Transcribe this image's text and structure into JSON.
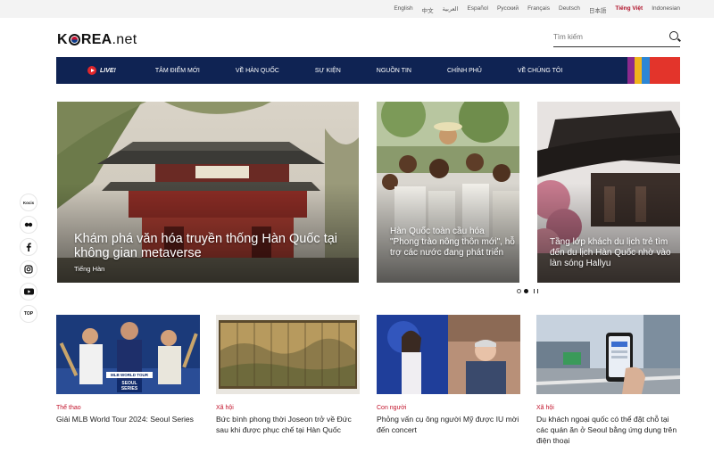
{
  "languages": [
    {
      "label": "English",
      "active": false
    },
    {
      "label": "中文",
      "active": false
    },
    {
      "label": "العربية",
      "active": false
    },
    {
      "label": "Español",
      "active": false
    },
    {
      "label": "Русский",
      "active": false
    },
    {
      "label": "Français",
      "active": false
    },
    {
      "label": "Deutsch",
      "active": false
    },
    {
      "label": "日本語",
      "active": false
    },
    {
      "label": "Tiếng Việt",
      "active": true
    },
    {
      "label": "Indonesian",
      "active": false
    }
  ],
  "logo": {
    "left": "K",
    "mid": "REA",
    "suffix": ".net"
  },
  "search": {
    "placeholder": "Tìm kiếm"
  },
  "nav": {
    "live": "LIVE!",
    "items": [
      "TÂM ĐIỂM MỚI",
      "VỀ HÀN QUỐC",
      "SỰ KIỆN",
      "NGUỒN TIN",
      "CHÍNH PHỦ",
      "VỀ CHÚNG TÔI"
    ],
    "stripes": [
      "#8c2a8e",
      "#f0b41c",
      "#2c86d4",
      "#e3342b"
    ]
  },
  "social": [
    "KOCIS",
    "flickr-icon",
    "facebook-icon",
    "instagram-icon",
    "youtube-icon",
    "TOP"
  ],
  "social_labels": {
    "kocis": "Kocis",
    "top": "TOP"
  },
  "hero": [
    {
      "title": "Khám phá văn hóa truyền thống Hàn Quốc tại không gian metaverse",
      "sub": "Tiếng Hàn"
    },
    {
      "title": "Hàn Quốc toàn cầu hóa \"Phong trào nông thôn mới\", hỗ trợ các nước đang phát triển"
    },
    {
      "title": "Tầng lớp khách du lịch trẻ tìm đến du lịch Hàn Quốc nhờ vào làn sóng Hallyu"
    }
  ],
  "cards": [
    {
      "category": "Thể thao",
      "title": "Giải MLB World Tour 2024: Seoul Series"
    },
    {
      "category": "Xã hội",
      "title": "Bức bình phong thời Joseon trở về Đức sau khi được phục chế tại Hàn Quốc"
    },
    {
      "category": "Con người",
      "title": "Phỏng vấn cụ ông người Mỹ được IU mời đến concert"
    },
    {
      "category": "Xã hội",
      "title": "Du khách ngoại quốc có thể đặt chỗ tại các quán ăn ở Seoul bằng ứng dụng trên điện thoại"
    }
  ],
  "mlb_badge": {
    "line1": "MLB WORLD TOUR",
    "line2": "SEOUL",
    "line3": "SERIES"
  },
  "accent": "#c2132b",
  "nav_bg": "#0f2353"
}
